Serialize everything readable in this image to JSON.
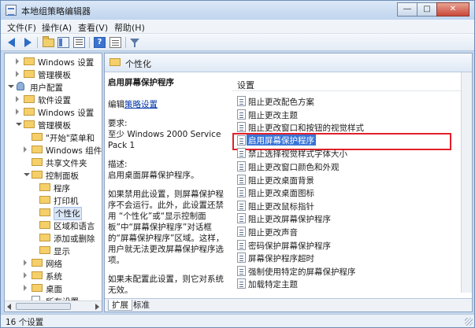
{
  "window": {
    "title": "本地组策略编辑器"
  },
  "menu": [
    "文件(F)",
    "操作(A)",
    "查看(V)",
    "帮助(H)"
  ],
  "tree": {
    "items": [
      {
        "label": "Windows 设置",
        "level": 1,
        "expander": "c",
        "icon": "folder-icon",
        "selected": false
      },
      {
        "label": "管理模板",
        "level": 1,
        "expander": "c",
        "icon": "folder-icon",
        "selected": false
      },
      {
        "label": "用户配置",
        "level": 0,
        "expander": "o",
        "icon": "user-icon",
        "selected": false
      },
      {
        "label": "软件设置",
        "level": 1,
        "expander": "c",
        "icon": "folder-icon",
        "selected": false
      },
      {
        "label": "Windows 设置",
        "level": 1,
        "expander": "c",
        "icon": "folder-icon",
        "selected": false
      },
      {
        "label": "管理模板",
        "level": 1,
        "expander": "o",
        "icon": "folder-icon",
        "selected": false
      },
      {
        "label": "\"开始\"菜单和",
        "level": 2,
        "expander": "",
        "icon": "folder-icon",
        "selected": false
      },
      {
        "label": "Windows 组件",
        "level": 2,
        "expander": "c",
        "icon": "folder-icon",
        "selected": false
      },
      {
        "label": "共享文件夹",
        "level": 2,
        "expander": "",
        "icon": "folder-icon",
        "selected": false
      },
      {
        "label": "控制面板",
        "level": 2,
        "expander": "o",
        "icon": "folder-icon",
        "selected": false
      },
      {
        "label": "程序",
        "level": 3,
        "expander": "",
        "icon": "folder-icon",
        "selected": false
      },
      {
        "label": "打印机",
        "level": 3,
        "expander": "",
        "icon": "folder-icon",
        "selected": false
      },
      {
        "label": "个性化",
        "level": 3,
        "expander": "",
        "icon": "folder-icon",
        "selected": true
      },
      {
        "label": "区域和语言",
        "level": 3,
        "expander": "",
        "icon": "folder-icon",
        "selected": false
      },
      {
        "label": "添加或删除",
        "level": 3,
        "expander": "",
        "icon": "folder-icon",
        "selected": false
      },
      {
        "label": "显示",
        "level": 3,
        "expander": "",
        "icon": "folder-icon",
        "selected": false
      },
      {
        "label": "网络",
        "level": 2,
        "expander": "c",
        "icon": "folder-icon",
        "selected": false
      },
      {
        "label": "系统",
        "level": 2,
        "expander": "c",
        "icon": "folder-icon",
        "selected": false
      },
      {
        "label": "桌面",
        "level": 2,
        "expander": "c",
        "icon": "folder-icon",
        "selected": false
      },
      {
        "label": "所有设置",
        "level": 2,
        "expander": "",
        "icon": "document-icon",
        "selected": false
      }
    ]
  },
  "path": {
    "label": "个性化"
  },
  "description": {
    "heading": "启用屏幕保护程序",
    "edit_prefix": "编辑",
    "edit_link": "策略设置",
    "req_label": "要求:",
    "req_text": "至少 Windows 2000 Service Pack 1",
    "desc_label": "描述:",
    "desc_text": "启用桌面屏幕保护程序。",
    "para1": "如果禁用此设置，则屏幕保护程序不会运行。此外，此设置还禁用 “个性化”或“显示控制面板”中“屏幕保护程序”对话框的“屏幕保护程序”区域。这样，用户就无法更改屏幕保护程序选项。",
    "para2": "如果未配置此设置，则它对系统无效。"
  },
  "list": {
    "header": "设置",
    "items": [
      {
        "label": "阻止更改配色方案",
        "selected": false
      },
      {
        "label": "阻止更改主题",
        "selected": false
      },
      {
        "label": "阻止更改窗口和按钮的视觉样式",
        "selected": false
      },
      {
        "label": "启用屏幕保护程序",
        "selected": true
      },
      {
        "label": "禁止选择视觉样式字体大小",
        "selected": false
      },
      {
        "label": "阻止更改窗口颜色和外观",
        "selected": false
      },
      {
        "label": "阻止更改桌面背景",
        "selected": false
      },
      {
        "label": "阻止更改桌面图标",
        "selected": false
      },
      {
        "label": "阻止更改鼠标指针",
        "selected": false
      },
      {
        "label": "阻止更改屏幕保护程序",
        "selected": false
      },
      {
        "label": "阻止更改声音",
        "selected": false
      },
      {
        "label": "密码保护屏幕保护程序",
        "selected": false
      },
      {
        "label": "屏幕保护程序超时",
        "selected": false
      },
      {
        "label": "强制使用特定的屏幕保护程序",
        "selected": false
      },
      {
        "label": "加载特定主题",
        "selected": false
      }
    ]
  },
  "tabs": [
    {
      "label": "扩展",
      "active": true
    },
    {
      "label": "标准",
      "active": false
    }
  ],
  "status": {
    "text": "16 个设置"
  }
}
